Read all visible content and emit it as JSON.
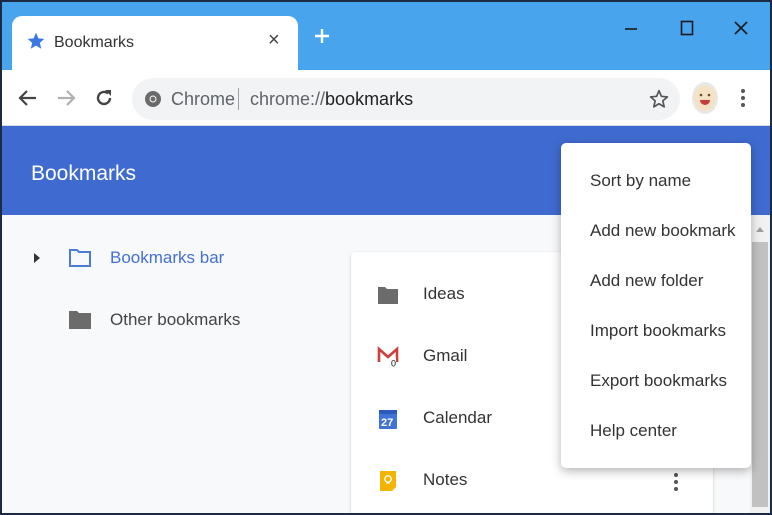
{
  "browser": {
    "tab": {
      "title": "Bookmarks",
      "icon": "star-icon",
      "close_glyph": "×"
    },
    "new_tab_icon": "plus-icon",
    "window_controls": [
      "minimize-icon",
      "maximize-icon",
      "close-icon"
    ],
    "omnibox": {
      "site_label": "Chrome",
      "url_scheme": "chrome://",
      "url_host": "bookmarks",
      "security_icon": "chrome-icon"
    },
    "toolbar_icons": [
      "back-arrow-icon",
      "forward-arrow-icon",
      "reload-icon",
      "bookmark-star-icon",
      "avatar-icon",
      "menu-kebab-icon"
    ]
  },
  "page": {
    "title": "Bookmarks",
    "accent_color": "#3f6bd0"
  },
  "sidebar": {
    "items": [
      {
        "label": "Bookmarks bar",
        "icon": "folder-outline-icon",
        "selected": true,
        "expandable": true
      },
      {
        "label": "Other bookmarks",
        "icon": "folder-icon",
        "selected": false,
        "expandable": false
      }
    ]
  },
  "list": {
    "items": [
      {
        "label": "Ideas",
        "icon": "folder-icon"
      },
      {
        "label": "Gmail",
        "icon": "gmail-icon"
      },
      {
        "label": "Calendar",
        "icon": "calendar-icon",
        "icon_text": "27"
      },
      {
        "label": "Notes",
        "icon": "keep-notes-icon"
      }
    ]
  },
  "menu": {
    "items": [
      {
        "label": "Sort by name"
      },
      {
        "label": "Add new bookmark"
      },
      {
        "label": "Add new folder"
      },
      {
        "label": "Import bookmarks"
      },
      {
        "label": "Export bookmarks"
      },
      {
        "label": "Help center"
      }
    ]
  }
}
